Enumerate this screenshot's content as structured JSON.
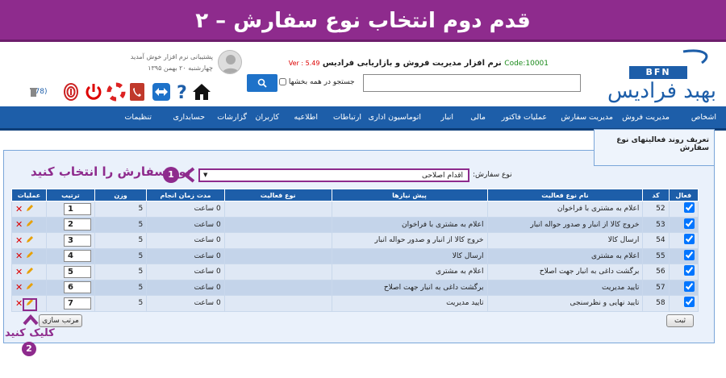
{
  "banner": {
    "title": "۲ – قدم دوم انتخاب نوع سفارش"
  },
  "header": {
    "app_title": "نرم افزار مدیریت فروش و بازاریابی فرادیس",
    "code": "Code:10001",
    "version": "Ver : 5.49",
    "search_placeholder": "",
    "search_all_label": "جستجو در همه بخشها",
    "welcome": "پشتیبانی نرم افزار خوش آمدید",
    "date": "چهارشنبه ۲۰ بهمن ۱۳۹۵",
    "notify_count": "(78)",
    "logo_text": "بهبد فرادیس",
    "logo_badge": "BFN"
  },
  "nav": {
    "items": [
      "اشخاص",
      "مدیریت فروش",
      "مدیریت سفارش",
      "عملیات فاکتور",
      "مالی",
      "انبار",
      "اتوماسیون اداری",
      "ارتباطات",
      "اطلاعیه",
      "کاربران",
      "گزارشات",
      "حسابداری",
      "تنظیمات"
    ]
  },
  "form": {
    "legend": "تعریف روند فعالیتهای نوع سفارش",
    "order_type_label": "نوع سفارش:",
    "order_type_value": "اقدام اصلاحی",
    "step1_text": "نوع سفارش را انتخاب کنید",
    "step1_num": "1",
    "step2_text": "کلیک کنید",
    "step2_num": "2",
    "save_label": "ثبت",
    "sort_label": "مرتب سازی"
  },
  "table": {
    "headers": [
      "فعال",
      "کد",
      "نام نوع فعالیت",
      "پیش نیازها",
      "نوع فعالیت",
      "مدت زمان انجام",
      "وزن",
      "ترتیب",
      "عملیات"
    ],
    "rows": [
      {
        "code": "52",
        "name": "اعلام به مشتری با فراخوان",
        "prereq": "",
        "type": "",
        "duration": "0 ساعت",
        "weight": "5",
        "order": "1"
      },
      {
        "code": "53",
        "name": "خروج کالا از انبار و صدور حواله انبار",
        "prereq": "اعلام به مشتری با فراخوان",
        "type": "",
        "duration": "0 ساعت",
        "weight": "5",
        "order": "2"
      },
      {
        "code": "54",
        "name": "ارسال کالا",
        "prereq": "خروج کالا از انبار و صدور حواله انبار",
        "type": "",
        "duration": "0 ساعت",
        "weight": "5",
        "order": "3"
      },
      {
        "code": "55",
        "name": "اعلام به مشتری",
        "prereq": "ارسال کالا",
        "type": "",
        "duration": "0 ساعت",
        "weight": "5",
        "order": "4"
      },
      {
        "code": "56",
        "name": "برگشت داغی به انبار جهت اصلاح",
        "prereq": "اعلام به مشتری",
        "type": "",
        "duration": "0 ساعت",
        "weight": "5",
        "order": "5"
      },
      {
        "code": "57",
        "name": "تایید مدیریت",
        "prereq": "برگشت داغی به انبار جهت اصلاح",
        "type": "",
        "duration": "0 ساعت",
        "weight": "5",
        "order": "6"
      },
      {
        "code": "58",
        "name": "تایید نهایی و نظرسنجی",
        "prereq": "تایید مدیریت",
        "type": "",
        "duration": "0 ساعت",
        "weight": "5",
        "order": "7"
      }
    ]
  },
  "colors": {
    "banner": "#8e2b8d",
    "nav": "#1d5ea9",
    "accent": "#8e2b8d"
  }
}
